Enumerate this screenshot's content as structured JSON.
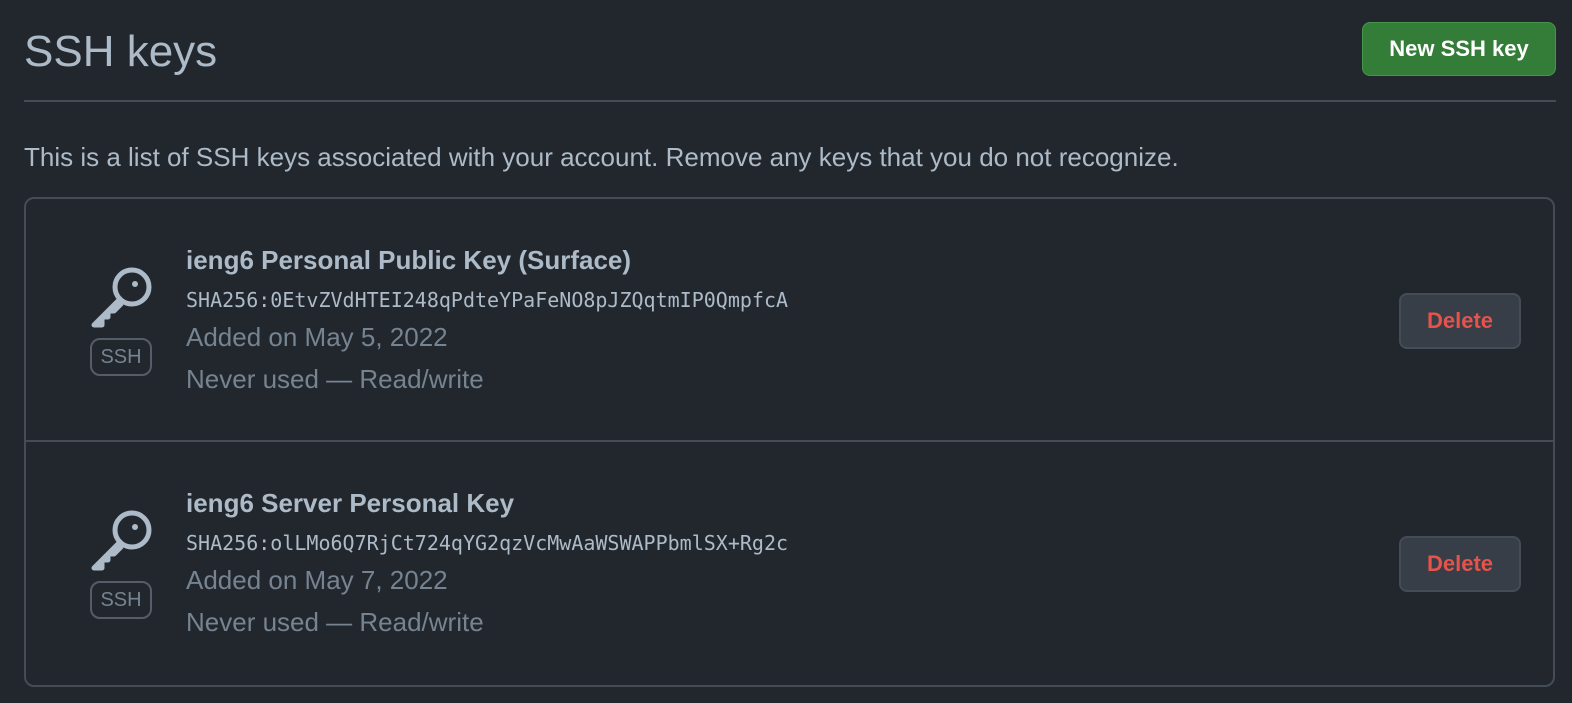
{
  "header": {
    "title": "SSH keys",
    "new_key_label": "New SSH key"
  },
  "intro": "This is a list of SSH keys associated with your account. Remove any keys that you do not recognize.",
  "keys": [
    {
      "title": "ieng6 Personal Public Key (Surface)",
      "fingerprint": "SHA256:0EtvZVdHTEI248qPdteYPaFeNO8pJZQqtmIP0QmpfcA",
      "added": "Added on May 5, 2022",
      "usage": "Never used — Read/write",
      "badge": "SSH",
      "icon": "key-icon",
      "delete_label": "Delete"
    },
    {
      "title": "ieng6 Server Personal Key",
      "fingerprint": "SHA256:olLMo6Q7RjCt724qYG2qzVcMwAaWSWAPPbmlSX+Rg2c",
      "added": "Added on May 7, 2022",
      "usage": "Never used — Read/write",
      "badge": "SSH",
      "icon": "key-icon",
      "delete_label": "Delete"
    }
  ],
  "colors": {
    "background": "#22272e",
    "border": "#444c56",
    "primary_button": "#347d39",
    "danger_text": "#e5534b",
    "muted_text": "#768390",
    "default_text": "#adbac7"
  }
}
